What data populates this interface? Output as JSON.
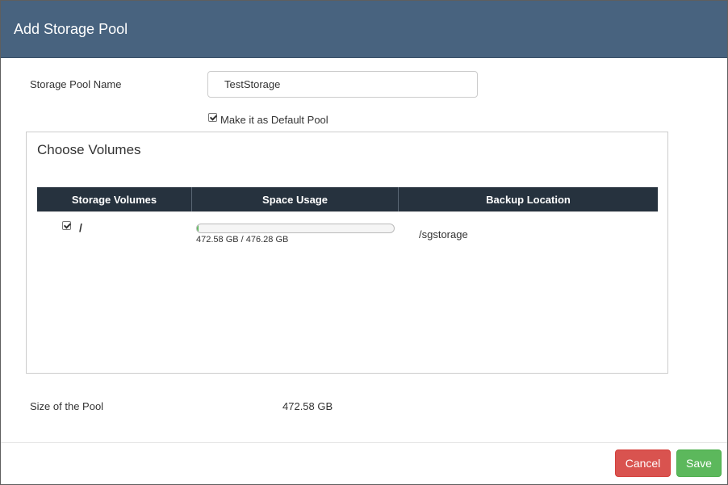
{
  "dialog": {
    "title": "Add Storage Pool"
  },
  "form": {
    "pool_name_label": "Storage Pool Name",
    "pool_name_value": "TestStorage",
    "default_pool_label": "Make it as Default Pool",
    "default_pool_checked": true
  },
  "volumes": {
    "title": "Choose Volumes",
    "columns": [
      "Storage Volumes",
      "Space Usage",
      "Backup Location"
    ],
    "rows": [
      {
        "checked": true,
        "volume": "/",
        "usage_text": "472.58 GB / 476.28 GB",
        "usage_fraction": 0.008,
        "backup_location": "/sgstorage"
      }
    ]
  },
  "summary": {
    "size_label": "Size of the Pool",
    "size_value": "472.58 GB"
  },
  "buttons": {
    "cancel": "Cancel",
    "save": "Save"
  },
  "colors": {
    "header_bg": "#48637f",
    "table_head_bg": "#26323e",
    "cancel": "#d9534f",
    "save": "#5cb85c"
  }
}
